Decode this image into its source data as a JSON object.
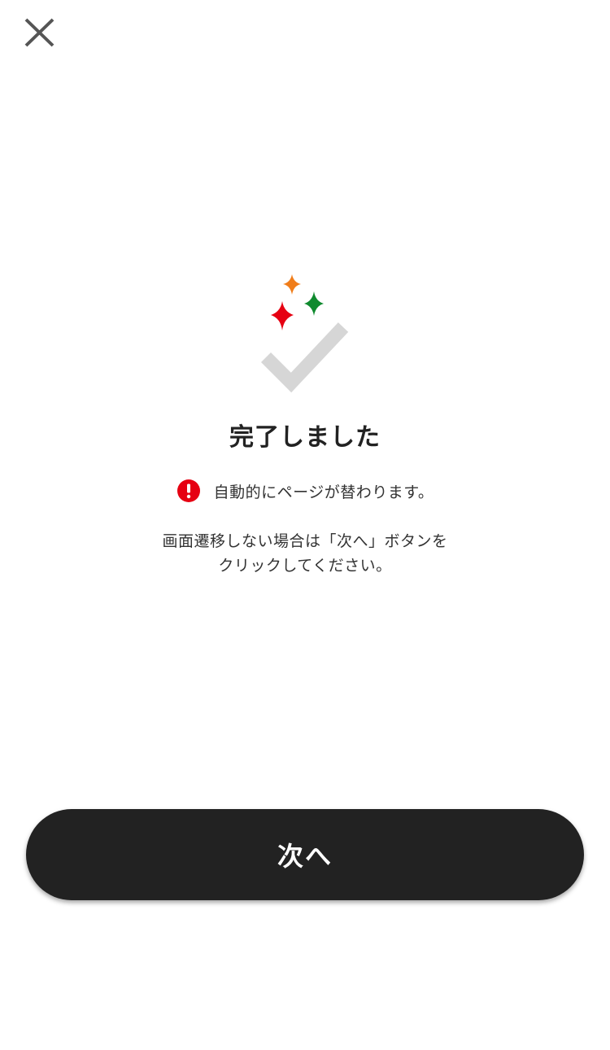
{
  "header": {
    "close_icon": "close-icon"
  },
  "illustration": {
    "icon": "completed-check-with-sparkles-icon",
    "colors": {
      "check": "#d6d6d6",
      "sparkle_orange": "#f07d1a",
      "sparkle_green": "#0f8a2e",
      "sparkle_red": "#e60012"
    }
  },
  "main": {
    "title": "完了しました",
    "notice": {
      "icon": "alert-circle-icon",
      "icon_color": "#e60012",
      "text": "自動的にページが替わります。"
    },
    "description": {
      "line1": "画面遷移しない場合は「次へ」ボタンを",
      "line2": "クリックしてください。"
    }
  },
  "footer": {
    "next_button_label": "次へ",
    "button_color": "#222222"
  }
}
